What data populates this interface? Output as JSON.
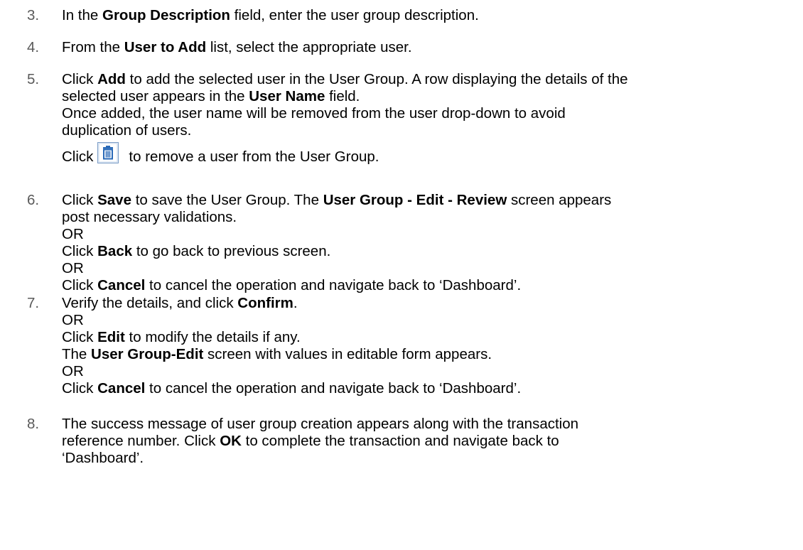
{
  "steps": [
    {
      "number": "3.",
      "lines": [
        [
          {
            "t": "In the "
          },
          {
            "t": "Group Description",
            "b": true
          },
          {
            "t": " field, enter the user group description."
          }
        ]
      ]
    },
    {
      "number": "4.",
      "lines": [
        [
          {
            "t": "From the "
          },
          {
            "t": "User to Add",
            "b": true
          },
          {
            "t": " list, select the appropriate user."
          }
        ]
      ]
    },
    {
      "number": "5.",
      "lines": [
        [
          {
            "t": "Click "
          },
          {
            "t": "Add",
            "b": true
          },
          {
            "t": " to add the selected user in the User Group. A row displaying the details of the"
          }
        ],
        [
          {
            "t": "selected user appears in the "
          },
          {
            "t": "User Name",
            "b": true
          },
          {
            "t": " field."
          }
        ],
        [
          {
            "t": "Once added, the user name will be removed from the user drop-down to avoid"
          }
        ],
        [
          {
            "t": "duplication of users."
          }
        ]
      ],
      "icon_line": {
        "before": "Click",
        "after": "to remove a user from the User Group.",
        "icon": "trash-icon"
      }
    },
    {
      "number": "6.",
      "lines": [
        [
          {
            "t": "Click "
          },
          {
            "t": "Save",
            "b": true
          },
          {
            "t": " to save the User Group. The "
          },
          {
            "t": "User Group - Edit - Review",
            "b": true
          },
          {
            "t": " screen appears"
          }
        ],
        [
          {
            "t": "post necessary validations."
          }
        ],
        [
          {
            "t": "OR"
          }
        ],
        [
          {
            "t": "Click "
          },
          {
            "t": "Back",
            "b": true
          },
          {
            "t": " to go back to previous screen."
          }
        ],
        [
          {
            "t": "OR"
          }
        ],
        [
          {
            "t": "Click "
          },
          {
            "t": "Cancel",
            "b": true
          },
          {
            "t": " to cancel the operation and navigate back to ‘Dashboard’."
          }
        ]
      ]
    },
    {
      "number": "7.",
      "lines": [
        [
          {
            "t": "Verify the details, and click "
          },
          {
            "t": "Confirm",
            "b": true
          },
          {
            "t": "."
          }
        ],
        [
          {
            "t": "OR"
          }
        ],
        [
          {
            "t": "Click "
          },
          {
            "t": "Edit",
            "b": true
          },
          {
            "t": " to modify the details if any."
          }
        ],
        [
          {
            "t": "The "
          },
          {
            "t": "User Group-Edit",
            "b": true
          },
          {
            "t": " screen with values in editable form appears."
          }
        ],
        [
          {
            "t": "OR"
          }
        ],
        [
          {
            "t": "Click "
          },
          {
            "t": "Cancel",
            "b": true
          },
          {
            "t": " to cancel the operation and navigate back to ‘Dashboard’."
          }
        ]
      ]
    },
    {
      "number": "8.",
      "lines": [
        [
          {
            "t": "The success message of user group creation appears along with the transaction"
          }
        ],
        [
          {
            "t": "reference number. Click "
          },
          {
            "t": "OK",
            "b": true
          },
          {
            "t": " to complete the transaction and navigate back to"
          }
        ],
        [
          {
            "t": "‘Dashboard’."
          }
        ]
      ]
    }
  ],
  "colors": {
    "text": "#000000",
    "step_number": "#5a5a5a",
    "trash_icon_frame": "#7a9cc6",
    "trash_icon_glyph": "#2a6ab8"
  }
}
